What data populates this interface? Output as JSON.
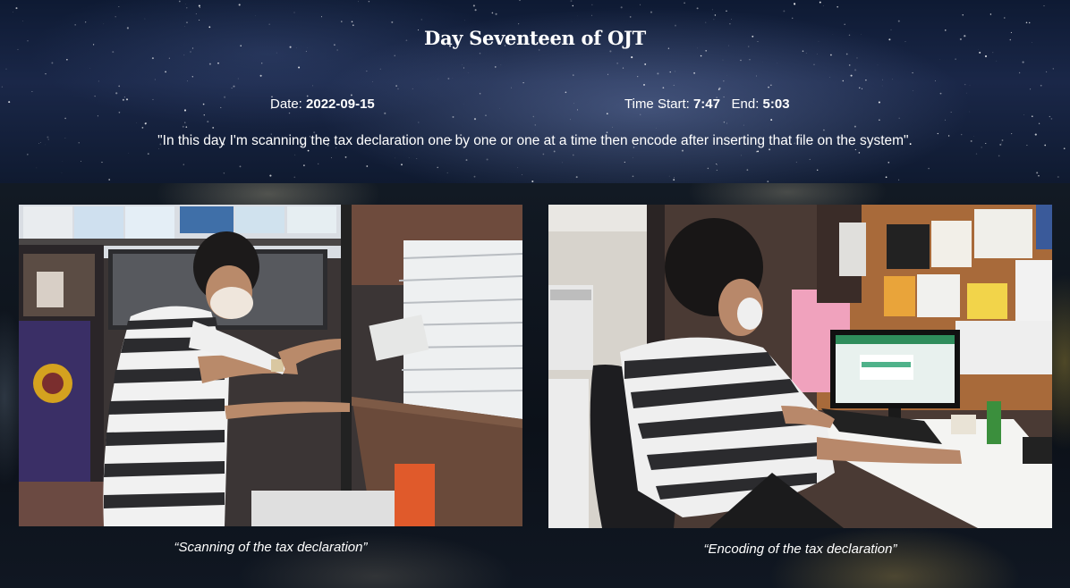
{
  "page": {
    "title": "Day Seventeen of OJT",
    "date_label": "Date:",
    "date_value": "2022-09-15",
    "time_start_label": "Time Start:",
    "time_start_value": "7:47",
    "end_label": "End:",
    "end_value": "5:03",
    "description": "\"In this day I'm scanning the tax declaration one by one or one at a time then encode after inserting that file on the system\"."
  },
  "gallery": [
    {
      "caption": "“Scanning of the tax declaration”"
    },
    {
      "caption": "“Encoding of the tax declaration”"
    }
  ],
  "colors": {
    "header_bg": "#1a2748",
    "text": "#ffffff",
    "lower_bg": "#0c1119"
  }
}
